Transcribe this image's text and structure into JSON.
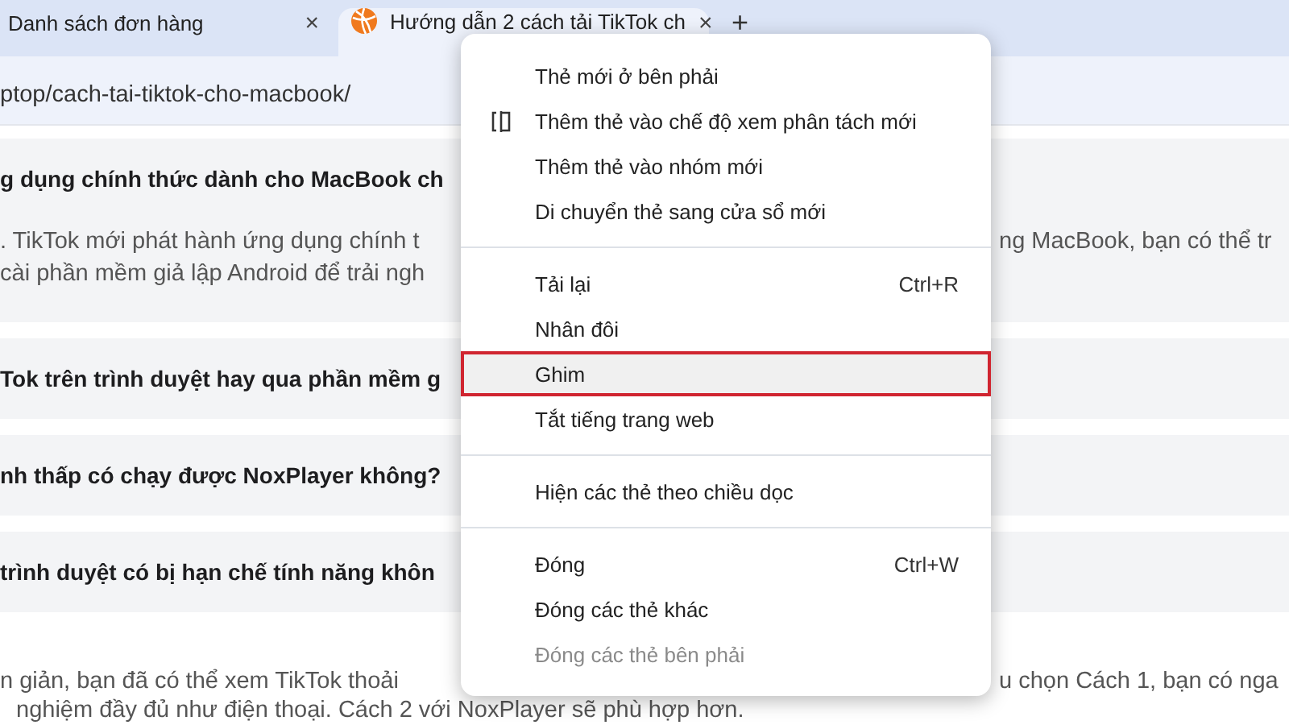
{
  "tabs": [
    {
      "title": "Danh sách đơn hàng",
      "close": "×",
      "selected": false
    },
    {
      "title": "Hướng dẫn 2 cách tải TikTok ch",
      "close": "×",
      "selected": true
    }
  ],
  "new_tab": "+",
  "address_bar": {
    "url": "ptop/cach-tai-tiktok-cho-macbook/"
  },
  "faq": [
    {
      "question": "g dụng chính thức dành cho MacBook ch",
      "answer_lines": [
        {
          "left": ". TikTok mới phát hành ứng dụng chính t",
          "right": "ng MacBook, bạn có thể tr"
        },
        {
          "left": "cài phần mềm giả lập Android để trải ngh"
        }
      ]
    },
    {
      "question": "Tok trên trình duyệt hay qua phần mềm g"
    },
    {
      "question": "nh thấp có chạy được NoxPlayer không?"
    },
    {
      "question": "trình duyệt có bị hạn chế tính năng khôn"
    }
  ],
  "conclusion_lines": [
    {
      "left": "n giản, bạn đã có thể xem TikTok thoải",
      "right": "u chọn Cách 1, bạn có nga"
    },
    {
      "left": "nghiệm đầy đủ như điện thoại. Cách 2 với NoxPlayer sẽ phù hợp hơn."
    }
  ],
  "context_menu": {
    "groups": [
      {
        "items": [
          {
            "label": "Thẻ mới ở bên phải",
            "disabled": false,
            "highlighted": false
          },
          {
            "label": "Thêm thẻ vào chế độ xem phân tách mới",
            "kind": "split",
            "disabled": false,
            "highlighted": false
          },
          {
            "label": "Thêm thẻ vào nhóm mới",
            "disabled": false,
            "highlighted": false
          },
          {
            "label": "Di chuyển thẻ sang cửa sổ mới",
            "disabled": false,
            "highlighted": false
          }
        ]
      },
      {
        "items": [
          {
            "label": "Tải lại",
            "shortcut": "Ctrl+R",
            "disabled": false,
            "highlighted": false
          },
          {
            "label": "Nhân đôi",
            "disabled": false,
            "highlighted": false
          },
          {
            "label": "Ghim",
            "disabled": false,
            "highlighted": true
          },
          {
            "label": "Tắt tiếng trang web",
            "disabled": false,
            "highlighted": false
          }
        ]
      },
      {
        "items": [
          {
            "label": "Hiện các thẻ theo chiều dọc",
            "disabled": false,
            "highlighted": false
          }
        ]
      },
      {
        "items": [
          {
            "label": "Đóng",
            "shortcut": "Ctrl+W",
            "disabled": false,
            "highlighted": false
          },
          {
            "label": "Đóng các thẻ khác",
            "disabled": false,
            "highlighted": false
          },
          {
            "label": "Đóng các thẻ bên phải",
            "disabled": true,
            "highlighted": false
          }
        ]
      }
    ]
  }
}
